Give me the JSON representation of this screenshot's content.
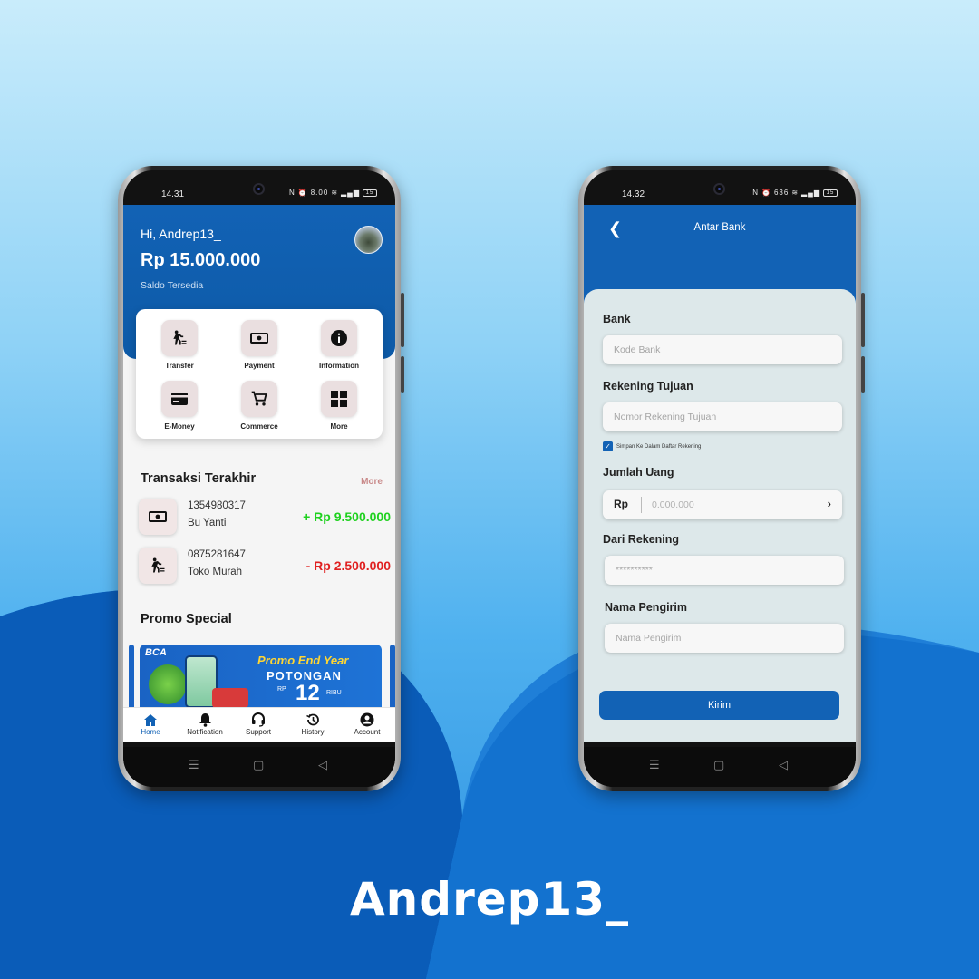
{
  "brand": "Andrep13_",
  "phone1": {
    "status": {
      "time": "14.31",
      "speed": "8.00",
      "battery": "15"
    },
    "greeting": "Hi, Andrep13_",
    "balance": "Rp 15.000.000",
    "balance_label": "Saldo Tersedia",
    "menu": [
      {
        "label": "Transfer",
        "icon": "transfer-icon"
      },
      {
        "label": "Payment",
        "icon": "cash-icon"
      },
      {
        "label": "Information",
        "icon": "info-icon"
      },
      {
        "label": "E-Money",
        "icon": "card-icon"
      },
      {
        "label": "Commerce",
        "icon": "cart-icon"
      },
      {
        "label": "More",
        "icon": "grid-icon"
      }
    ],
    "recent_title": "Transaksi Terakhir",
    "recent_more": "More",
    "transactions": [
      {
        "account": "1354980317",
        "name": "Bu Yanti",
        "amount": "+ Rp 9.500.000",
        "color": "#1fd11f",
        "icon": "cash-icon"
      },
      {
        "account": "0875281647",
        "name": "Toko Murah",
        "amount": "- Rp 2.500.000",
        "color": "#e02020",
        "icon": "transfer-icon"
      }
    ],
    "promo_title": "Promo Special",
    "promo": {
      "bank": "BCA",
      "line1": "Promo End Year",
      "line2": "POTONGAN",
      "rp": "RP",
      "value": "12",
      "unit": "RIBU"
    },
    "nav": [
      {
        "label": "Home",
        "icon": "home-icon"
      },
      {
        "label": "Notification",
        "icon": "bell-icon"
      },
      {
        "label": "Support",
        "icon": "headset-icon"
      },
      {
        "label": "History",
        "icon": "history-icon"
      },
      {
        "label": "Account",
        "icon": "account-icon"
      }
    ]
  },
  "phone2": {
    "status": {
      "time": "14.32",
      "speed": "636",
      "battery": "15"
    },
    "title": "Antar Bank",
    "fields": {
      "bank_label": "Bank",
      "bank_placeholder": "Kode Bank",
      "rekening_label": "Rekening Tujuan",
      "rekening_placeholder": "Nomor Rekening Tujuan",
      "save_check": "Simpan Ke Dalam Daftar Rekening",
      "jumlah_label": "Jumlah Uang",
      "currency": "Rp",
      "jumlah_placeholder": "0.000.000",
      "dari_label": "Dari Rekening",
      "dari_value": "**********",
      "nama_label": "Nama Pengirim",
      "nama_placeholder": "Nama Pengirim"
    },
    "submit": "Kirim"
  },
  "colors": {
    "primary": "#1262b5",
    "credit": "#1fd11f",
    "debit": "#e02020"
  }
}
